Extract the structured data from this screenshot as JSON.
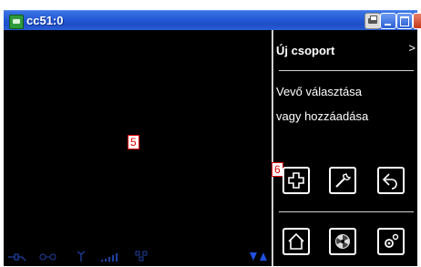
{
  "window": {
    "title": "cc51:0",
    "title_icon": "terminal-icon",
    "controls": [
      "print-icon",
      "minimize-icon",
      "maximize-icon",
      "close-icon"
    ]
  },
  "screen": {
    "left_area_marker": "5",
    "button_area_marker": "6",
    "status_icons": [
      "power-plug-icon",
      "network-icon",
      "antenna-icon",
      "signal-bars-icon",
      "lan-icon"
    ],
    "scroll_arrows_icon": "scroll-arrows-icon"
  },
  "right_panel": {
    "title": "Új csoport",
    "chevron": ">",
    "body_line1": "Vevő választása",
    "body_line2": "vagy hozzáadása",
    "buttons_row1": [
      "add-icon",
      "wrench-icon",
      "back-icon"
    ],
    "buttons_row2": [
      "home-icon",
      "fan-icon",
      "settings-icon"
    ]
  },
  "colors": {
    "titlebar": "#2357d4",
    "screen_bg": "#000000",
    "marker_text": "#e00000",
    "status_icons": "#1f3fa0"
  }
}
